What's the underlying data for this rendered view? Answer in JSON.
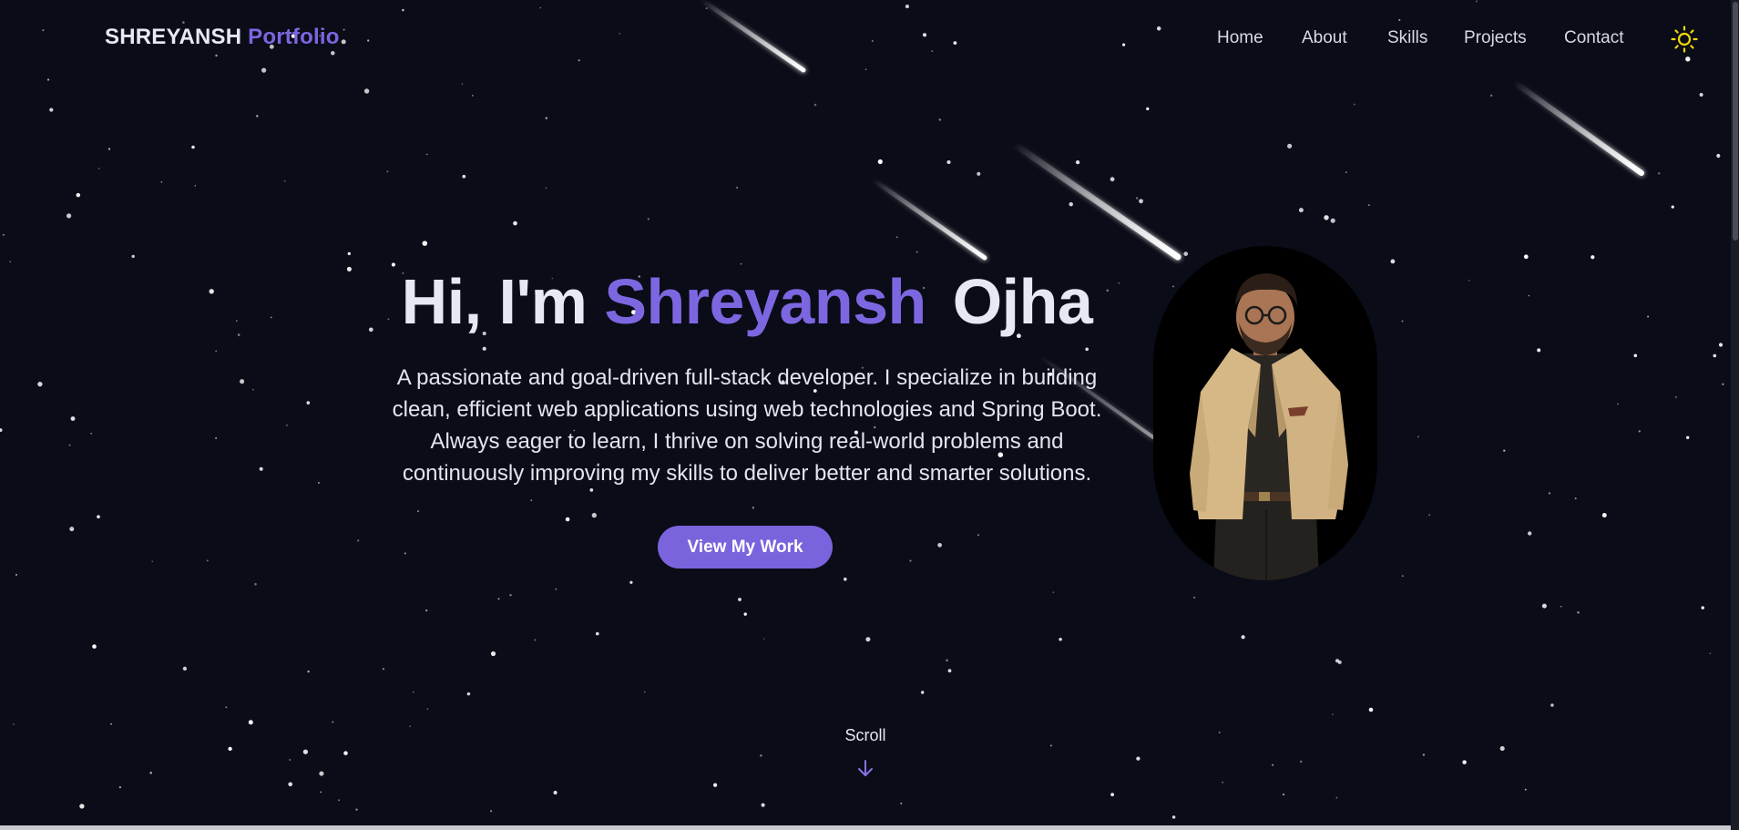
{
  "brand": {
    "name": "SHREYANSH",
    "accent": "Portfolio"
  },
  "nav": {
    "links": [
      "Home",
      "About",
      "Skills",
      "Projects",
      "Contact"
    ],
    "theme_toggle_icon": "sun-icon"
  },
  "hero": {
    "greeting": "Hi, I'm",
    "first_name": "Shreyansh",
    "last_name": "Ojha",
    "description_lines": [
      "A passionate and goal-driven full-stack developer. I specialize in building",
      "clean, efficient web applications using web technologies and Spring Boot.",
      "Always eager to learn, I thrive on solving real-world problems and",
      "continuously improving my skills to deliver better and smarter solutions."
    ],
    "cta_label": "View My Work"
  },
  "scroll": {
    "label": "Scroll",
    "icon": "arrow-down-icon"
  },
  "colors": {
    "background": "#0a0c17",
    "accent": "#7b63dd",
    "text": "#e6e8f3",
    "sun": "#f5d90a"
  }
}
